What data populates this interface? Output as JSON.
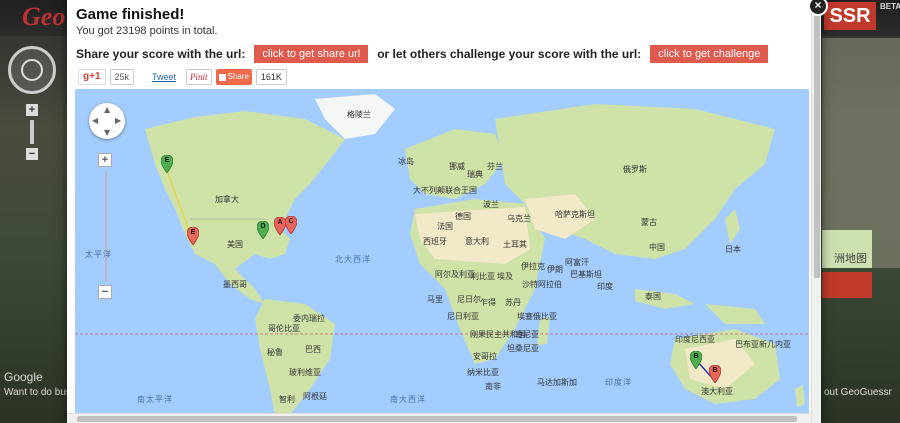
{
  "background": {
    "logo": "Geo",
    "right_word": "SSR",
    "beta": "BETA",
    "google": "Google",
    "hint": "Want to do bus",
    "about": "out GeoGuessr",
    "side_map_label": "洲地图"
  },
  "modal": {
    "title": "Game finished!",
    "subtitle": "You got 23198 points in total.",
    "share_text": "Share your score with the url:",
    "share_button": "click to get share url",
    "challenge_text": "or let others challenge your score with the url:",
    "challenge_button": "click to get challenge",
    "close_label": "×"
  },
  "social": {
    "gplus_label": "g+1",
    "gplus_count": "25k",
    "tweet_label": "Tweet",
    "pinit_label": "Pinit",
    "share_label": "Share",
    "share_count": "161K"
  },
  "map": {
    "zoom_in": "+",
    "zoom_out": "−",
    "labels": {
      "greenland": "格陵兰",
      "iceland": "冰岛",
      "canada": "加拿大",
      "usa": "美国",
      "mexico": "墨西哥",
      "venezuela": "委内瑞拉",
      "colombia": "哥伦比亚",
      "peru": "秘鲁",
      "brazil": "巴西",
      "bolivia": "玻利维亚",
      "argentina": "阿根廷",
      "chile": "智利",
      "norway": "挪威",
      "sweden": "瑞典",
      "finland": "芬兰",
      "russia": "俄罗斯",
      "uk": "大不列颠联合王国",
      "germany": "德国",
      "poland": "波兰",
      "ukraine": "乌克兰",
      "france": "法国",
      "spain": "西班牙",
      "italy": "意大利",
      "kazakhstan": "哈萨克斯坦",
      "mongolia": "蒙古",
      "china": "中国",
      "japan": "日本",
      "turkey": "土耳其",
      "iraq": "伊拉克",
      "iran": "伊朗",
      "afghanistan": "阿富汗",
      "pakistan": "巴基斯坦",
      "india": "印度",
      "saudi": "沙特阿拉伯",
      "egypt": "埃及",
      "libya": "利比亚",
      "algeria": "阿尔及利亚",
      "mali": "马里",
      "niger": "尼日尔",
      "chad": "乍得",
      "sudan": "苏丹",
      "nigeria": "尼日利亚",
      "ethiopia": "埃塞俄比亚",
      "drc": "刚果民主共和国",
      "kenya": "肯尼亚",
      "tanzania": "坦桑尼亚",
      "angola": "安哥拉",
      "namibia": "纳米比亚",
      "south_africa": "南非",
      "madagascar": "马达加斯加",
      "thailand": "泰国",
      "indonesia": "印度尼西亚",
      "png": "巴布亚新几内亚",
      "australia": "澳大利亚",
      "pacific": "太平洋",
      "pacific_s": "南太平洋",
      "atlantic": "北大西洋",
      "atlantic_s": "南大西洋",
      "indian": "印度洋"
    },
    "markers": [
      {
        "letter": "E",
        "kind": "guess",
        "color": "#4caf50"
      },
      {
        "letter": "E",
        "kind": "actual",
        "color": "#e8665a"
      },
      {
        "letter": "D",
        "kind": "guess",
        "color": "#4caf50"
      },
      {
        "letter": "A",
        "kind": "actual",
        "color": "#e8665a"
      },
      {
        "letter": "C",
        "kind": "actual",
        "color": "#e8665a"
      },
      {
        "letter": "B",
        "kind": "guess",
        "color": "#4caf50"
      },
      {
        "letter": "B",
        "kind": "actual",
        "color": "#e8665a"
      }
    ]
  },
  "colors": {
    "accent_red": "#e05a4e",
    "ocean": "#a3ccff",
    "land": "#cfe3a8",
    "desert": "#f2e9c9",
    "guess_marker": "#4caf50",
    "actual_marker": "#e8665a"
  }
}
